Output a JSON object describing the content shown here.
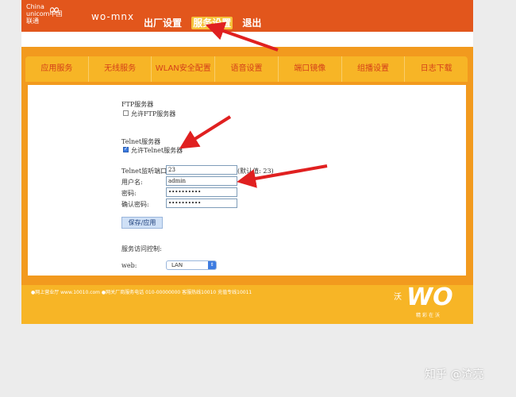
{
  "header": {
    "logo_text_line1": "China",
    "logo_text_line2": "unicom中国联通",
    "brand": "wo-mnx",
    "nav": [
      "出厂设置",
      "服务设置",
      "退出"
    ],
    "active_nav": "服务设置"
  },
  "tabs": [
    "应用服务",
    "无线服务",
    "WLAN安全配置",
    "语音设置",
    "端口镜像",
    "组播设置",
    "日志下载"
  ],
  "form": {
    "ftp_section": "FTP服务器",
    "ftp_checkbox_label": "允许FTP服务器",
    "ftp_checked": false,
    "telnet_section": "Telnet服务器",
    "telnet_checkbox_label": "允许Telnet服务器",
    "telnet_checked": true,
    "port_label": "Telnet监听端口:",
    "port_value": "23",
    "port_default": "(默认值: 23)",
    "username_label": "用户名:",
    "username_value": "admin",
    "password_label": "密码:",
    "password_value": "••••••••••",
    "confirm_label": "确认密码:",
    "confirm_value": "••••••••••",
    "save_button": "保存/应用",
    "access_section": "服务访问控制:",
    "web_label": "web:",
    "web_value": "LAN"
  },
  "footer": {
    "text": "●网上营业厅 www.10010.com ●网关厂商服务电话 010-00000000   客服热线10010  充值专线10011",
    "logo_small": "沃",
    "logo_big": "WO",
    "slogan": "精彩在沃"
  },
  "watermark": "知乎 @渣亮",
  "colors": {
    "header_orange": "#e2561c",
    "band_orange": "#f29a1e",
    "tab_yellow": "#f7b526",
    "arrow_red": "#e02020"
  }
}
